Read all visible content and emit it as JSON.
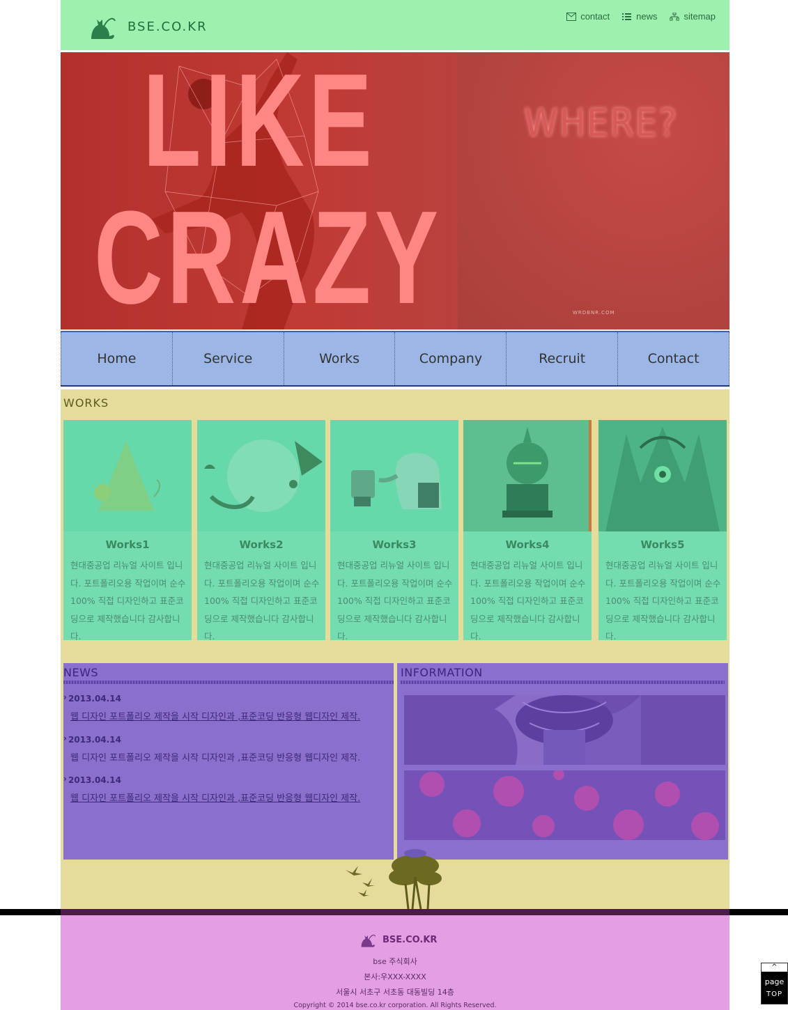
{
  "header": {
    "logo_text": "BSE.CO.KR",
    "util_links": [
      {
        "label": "contact",
        "icon": "mail-icon"
      },
      {
        "label": "news",
        "icon": "list-icon"
      },
      {
        "label": "sitemap",
        "icon": "sitemap-icon"
      }
    ]
  },
  "banner": {
    "line1": "LIKE",
    "line2": "CRAZY",
    "where": "WHERE?",
    "credit": "WRDBNR.COM"
  },
  "nav": {
    "items": [
      "Home",
      "Service",
      "Works",
      "Company",
      "Recruit",
      "Contact"
    ]
  },
  "works": {
    "title": "WORKS",
    "items": [
      {
        "title": "Works1",
        "desc": "현대중공업 리뉴얼 사이트 입니다. 포트폴리오용 작업이며 순수 100% 직접 디자인하고 표준코딩으로 제작했습니다 감사합니다."
      },
      {
        "title": "Works2",
        "desc": "현대중공업 리뉴얼 사이트 입니다. 포트폴리오용 작업이며 순수 100% 직접 디자인하고 표준코딩으로 제작했습니다 감사합니다."
      },
      {
        "title": "Works3",
        "desc": "현대중공업 리뉴얼 사이트 입니다. 포트폴리오용 작업이며 순수 100% 직접 디자인하고 표준코딩으로 제작했습니다 감사합니다."
      },
      {
        "title": "Works4",
        "desc": "현대중공업 리뉴얼 사이트 입니다. 포트폴리오용 작업이며 순수 100% 직접 디자인하고 표준코딩으로 제작했습니다 감사합니다."
      },
      {
        "title": "Works5",
        "desc": "현대중공업 리뉴얼 사이트 입니다. 포트폴리오용 작업이며 순수 100% 직접 디자인하고 표준코딩으로 제작했습니다 감사합니다."
      }
    ]
  },
  "news": {
    "title": "NEWS",
    "items": [
      {
        "date": "2013.04.14",
        "text": "웹 디자인 포트폴리오 제작을 시작 디자인과 ,표준코딩 반응형 웹디자인 제작."
      },
      {
        "date": "2013.04.14",
        "text": "웹 디자인 포트폴리오 제작을 시작 디자인과 ,표준코딩 반응형 웹디자인 제작."
      },
      {
        "date": "2013.04.14",
        "text": "웹 디자인 포트폴리오 제작을 시작 디자인과 ,표준코딩 반응형 웹디자인 제작."
      }
    ]
  },
  "info": {
    "title": "INFORMATION"
  },
  "footer": {
    "logo_text": "BSE.CO.KR",
    "company": "bse 주식회사",
    "hq": "본사:우XXX-XXXX",
    "address": "서울시 서초구 서초동 대동빌딩 14층",
    "copyright": "Copyright © 2014 bse.co.kr corporation. All Rights Reserved."
  },
  "page_top": {
    "arrow": "^",
    "label1": "page",
    "label2": "TOP"
  },
  "colors": {
    "header_bg": "#9ef0ae",
    "banner_bg": "#b83d3b",
    "nav_bg": "#9cb6e6",
    "content_bg": "#e5dc9b",
    "works_bg": "#74ddb0",
    "news_bg": "#8a6fcc",
    "footer_bg": "#e49ee3"
  }
}
